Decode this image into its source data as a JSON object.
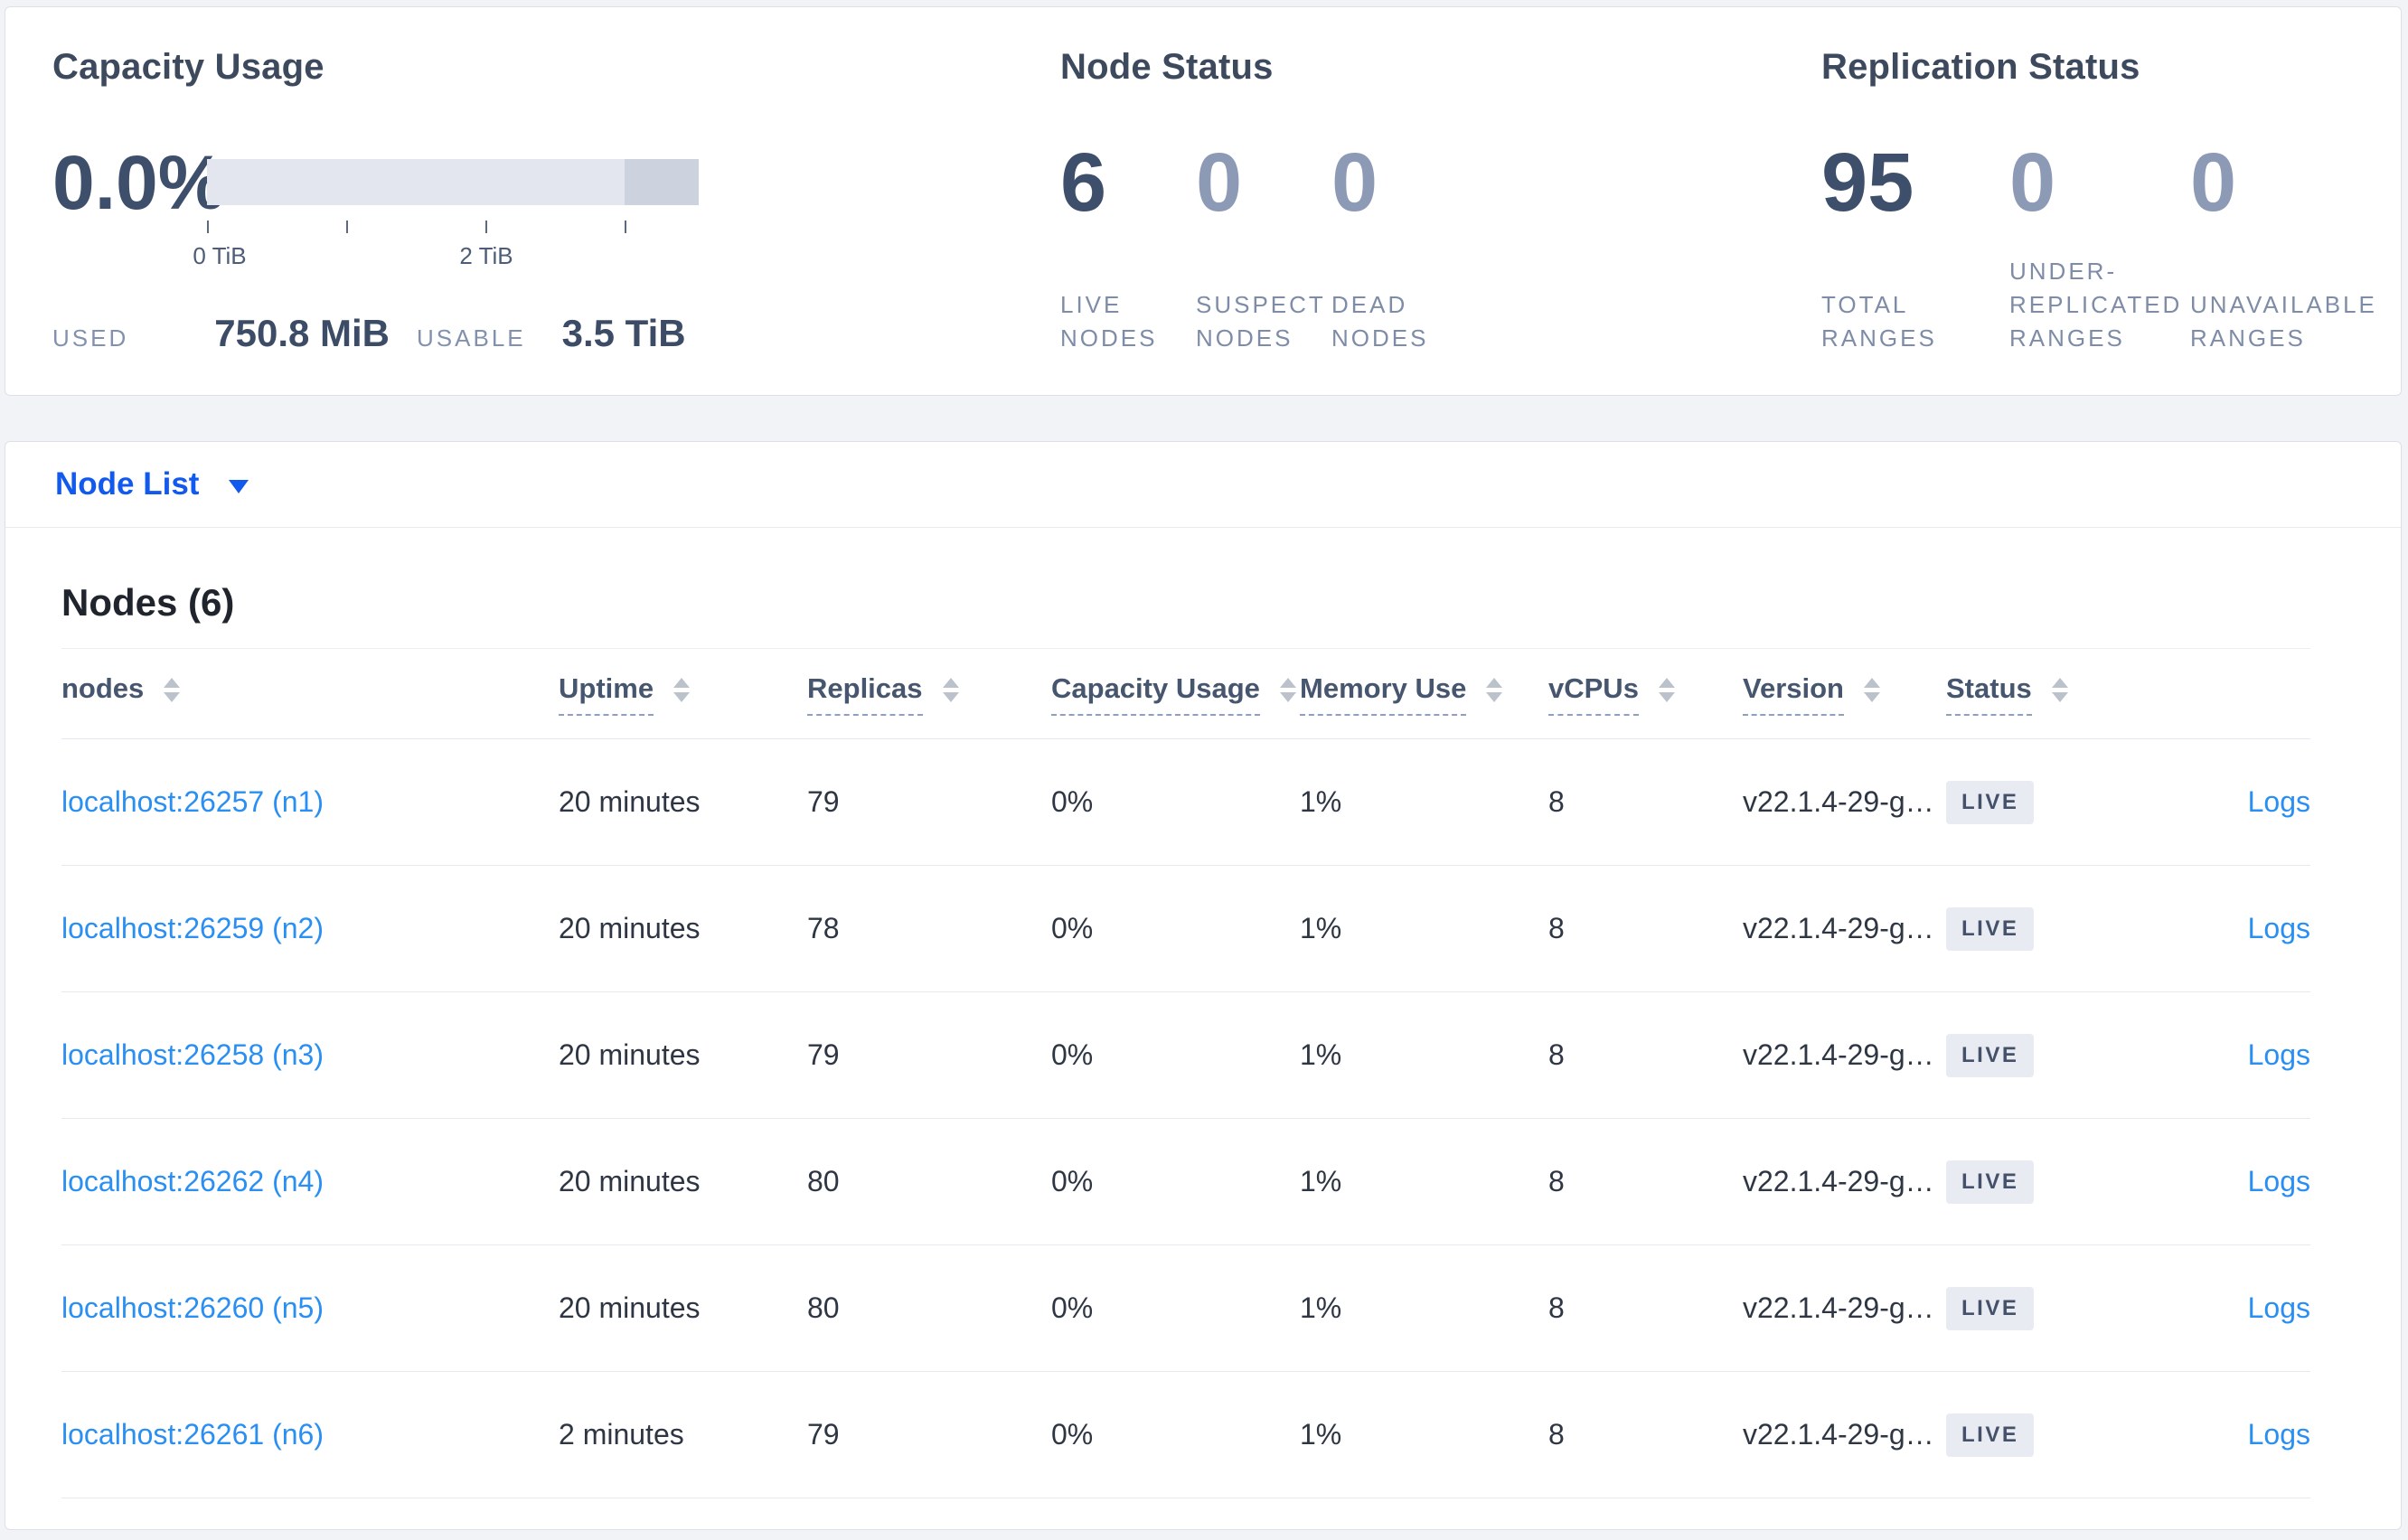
{
  "colors": {
    "accent_blue": "#1259ee",
    "link_blue": "#2a8ff2",
    "title_slate": "#3d4a5e",
    "metric_dark": "#3e4f6b",
    "metric_muted": "#8c9ab5",
    "label_muted": "#7e8ca8",
    "badge_bg": "#e8ebf1",
    "badge_text": "#45516b",
    "bar_light": "#e3e6ee",
    "bar_dark": "#ccd2de"
  },
  "summary": {
    "capacity": {
      "title": "Capacity Usage",
      "percent": "0.0%",
      "tick_labels": [
        "0 TiB",
        "2 TiB"
      ],
      "used_label": "USED",
      "used_value": "750.8 MiB",
      "usable_label": "USABLE",
      "usable_value": "3.5 TiB"
    },
    "node_status": {
      "title": "Node Status",
      "stats": [
        {
          "value": "6",
          "lines": [
            "LIVE",
            "NODES"
          ]
        },
        {
          "value": "0",
          "lines": [
            "SUSPECT",
            "NODES"
          ]
        },
        {
          "value": "0",
          "lines": [
            "DEAD",
            "NODES"
          ]
        }
      ]
    },
    "replication": {
      "title": "Replication Status",
      "stats": [
        {
          "value": "95",
          "lines": [
            "TOTAL",
            "RANGES"
          ]
        },
        {
          "value": "0",
          "lines": [
            "UNDER-",
            "REPLICATED",
            "RANGES"
          ]
        },
        {
          "value": "0",
          "lines": [
            "UNAVAILABLE",
            "RANGES"
          ]
        }
      ]
    }
  },
  "node_list": {
    "label": "Node List"
  },
  "nodes_table": {
    "title": "Nodes (6)",
    "columns": [
      {
        "label": "nodes"
      },
      {
        "label": "Uptime"
      },
      {
        "label": "Replicas"
      },
      {
        "label": "Capacity Usage"
      },
      {
        "label": "Memory Use"
      },
      {
        "label": "vCPUs"
      },
      {
        "label": "Version"
      },
      {
        "label": "Status"
      }
    ],
    "logs_label": "Logs",
    "rows": [
      {
        "node": "localhost:26257 (n1)",
        "uptime": "20 minutes",
        "replicas": "79",
        "capacity": "0%",
        "memory": "1%",
        "vcpus": "8",
        "version": "v22.1.4-29-g…",
        "status": "LIVE"
      },
      {
        "node": "localhost:26259 (n2)",
        "uptime": "20 minutes",
        "replicas": "78",
        "capacity": "0%",
        "memory": "1%",
        "vcpus": "8",
        "version": "v22.1.4-29-g…",
        "status": "LIVE"
      },
      {
        "node": "localhost:26258 (n3)",
        "uptime": "20 minutes",
        "replicas": "79",
        "capacity": "0%",
        "memory": "1%",
        "vcpus": "8",
        "version": "v22.1.4-29-g…",
        "status": "LIVE"
      },
      {
        "node": "localhost:26262 (n4)",
        "uptime": "20 minutes",
        "replicas": "80",
        "capacity": "0%",
        "memory": "1%",
        "vcpus": "8",
        "version": "v22.1.4-29-g…",
        "status": "LIVE"
      },
      {
        "node": "localhost:26260 (n5)",
        "uptime": "20 minutes",
        "replicas": "80",
        "capacity": "0%",
        "memory": "1%",
        "vcpus": "8",
        "version": "v22.1.4-29-g…",
        "status": "LIVE"
      },
      {
        "node": "localhost:26261 (n6)",
        "uptime": "2 minutes",
        "replicas": "79",
        "capacity": "0%",
        "memory": "1%",
        "vcpus": "8",
        "version": "v22.1.4-29-g…",
        "status": "LIVE"
      }
    ]
  }
}
